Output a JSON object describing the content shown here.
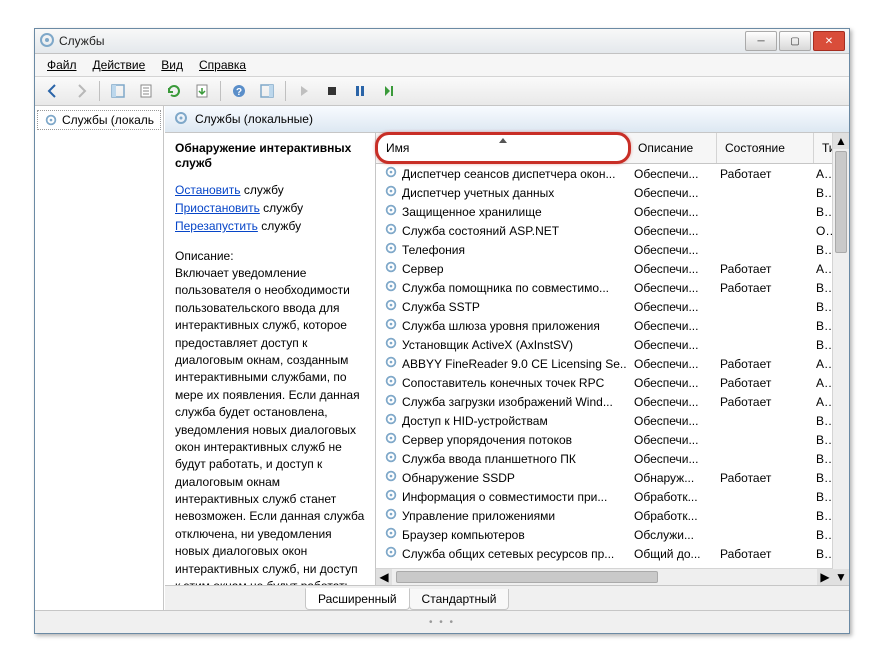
{
  "window": {
    "title": "Службы"
  },
  "menu": {
    "file": "Файл",
    "action": "Действие",
    "view": "Вид",
    "help": "Справка"
  },
  "tree": {
    "root": "Службы (локальны"
  },
  "main_header": "Службы (локальные)",
  "detail": {
    "title": "Обнаружение интерактивных служб",
    "links": {
      "stop_link": "Остановить",
      "stop_suffix": " службу",
      "pause_link": "Приостановить",
      "pause_suffix": " службу",
      "restart_link": "Перезапустить",
      "restart_suffix": " службу"
    },
    "desc_label": "Описание:",
    "desc_text": "Включает уведомление пользователя о необходимости пользовательского ввода для интерактивных служб, которое предоставляет доступ к диалоговым окнам, созданным интерактивными службами, по мере их появления. Если данная служба будет остановлена, уведомления новых диалоговых окон интерактивных служб не будут работать, и доступ к диалоговым окнам интерактивных служб станет невозможен. Если данная служба отключена, ни уведомления новых диалоговых окон интерактивных служб, ни доступ к этим окнам не будут работать"
  },
  "columns": {
    "name": "Имя",
    "desc": "Описание",
    "state": "Состояние",
    "type": "Тип за"
  },
  "tabs": {
    "extended": "Расширенный",
    "standard": "Стандартный"
  },
  "services": [
    {
      "name": "Диспетчер сеансов диспетчера окон...",
      "desc": "Обеспечи...",
      "state": "Работает",
      "type": "Автом"
    },
    {
      "name": "Диспетчер учетных данных",
      "desc": "Обеспечи...",
      "state": "",
      "type": "Вручн"
    },
    {
      "name": "Защищенное хранилище",
      "desc": "Обеспечи...",
      "state": "",
      "type": "Вручн"
    },
    {
      "name": "Служба состояний ASP.NET",
      "desc": "Обеспечи...",
      "state": "",
      "type": "Откли"
    },
    {
      "name": "Телефония",
      "desc": "Обеспечи...",
      "state": "",
      "type": "Вручн"
    },
    {
      "name": "Сервер",
      "desc": "Обеспечи...",
      "state": "Работает",
      "type": "Автом"
    },
    {
      "name": "Служба помощника по совместимо...",
      "desc": "Обеспечи...",
      "state": "Работает",
      "type": "Вручн"
    },
    {
      "name": "Служба SSTP",
      "desc": "Обеспечи...",
      "state": "",
      "type": "Вручн"
    },
    {
      "name": "Служба шлюза уровня приложения",
      "desc": "Обеспечи...",
      "state": "",
      "type": "Вручн"
    },
    {
      "name": "Установщик ActiveX (AxInstSV)",
      "desc": "Обеспечи...",
      "state": "",
      "type": "Вручн"
    },
    {
      "name": "ABBYY FineReader 9.0 CE Licensing Se...",
      "desc": "Обеспечи...",
      "state": "Работает",
      "type": "Автом"
    },
    {
      "name": "Сопоставитель конечных точек RPC",
      "desc": "Обеспечи...",
      "state": "Работает",
      "type": "Автом"
    },
    {
      "name": "Служба загрузки изображений Wind...",
      "desc": "Обеспечи...",
      "state": "Работает",
      "type": "Автом"
    },
    {
      "name": "Доступ к HID-устройствам",
      "desc": "Обеспечи...",
      "state": "",
      "type": "Вручн"
    },
    {
      "name": "Сервер упорядочения потоков",
      "desc": "Обеспечи...",
      "state": "",
      "type": "Вручн"
    },
    {
      "name": "Служба ввода планшетного ПК",
      "desc": "Обеспечи...",
      "state": "",
      "type": "Вручн"
    },
    {
      "name": "Обнаружение SSDP",
      "desc": "Обнаруж...",
      "state": "Работает",
      "type": "Вручн"
    },
    {
      "name": "Информация о совместимости при...",
      "desc": "Обработк...",
      "state": "",
      "type": "Вручн"
    },
    {
      "name": "Управление приложениями",
      "desc": "Обработк...",
      "state": "",
      "type": "Вручн"
    },
    {
      "name": "Браузер компьютеров",
      "desc": "Обслужи...",
      "state": "",
      "type": "Вручн"
    },
    {
      "name": "Служба общих сетевых ресурсов пр...",
      "desc": "Общий до...",
      "state": "Работает",
      "type": "Вручн"
    }
  ]
}
